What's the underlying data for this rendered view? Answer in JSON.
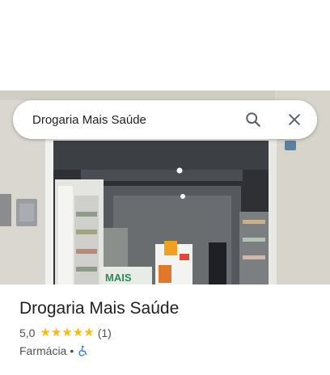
{
  "search": {
    "value": "Drogaria Mais Saúde"
  },
  "photo": {
    "sign_text": "MAIS"
  },
  "place": {
    "title": "Drogaria Mais Saúde",
    "rating": "5,0",
    "stars": "★★★★★",
    "review_count": "(1)",
    "category": "Farmácia",
    "separator": "•"
  },
  "colors": {
    "star": "#fbbc04",
    "accessibility": "#1a73e8",
    "title": "#202124",
    "secondary": "#4d5156"
  },
  "icons": {
    "search": "search-icon",
    "close": "close-icon",
    "accessibility": "wheelchair-icon"
  }
}
